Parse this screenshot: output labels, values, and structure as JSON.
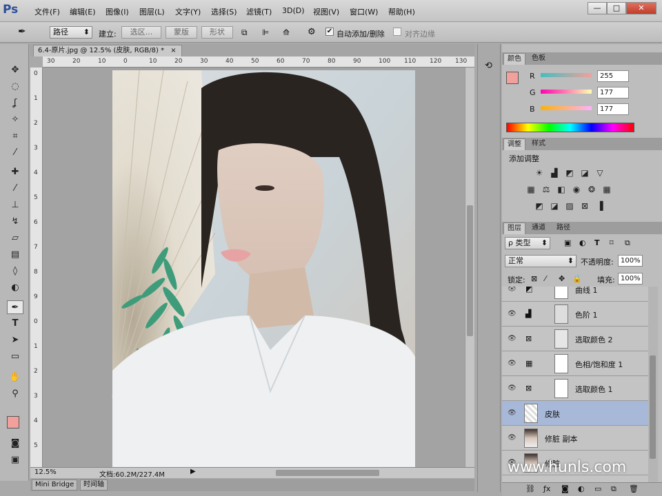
{
  "app": {
    "logo": "Ps"
  },
  "menu": [
    "文件(F)",
    "编辑(E)",
    "图像(I)",
    "图层(L)",
    "文字(Y)",
    "选择(S)",
    "滤镜(T)",
    "3D(D)",
    "视图(V)",
    "窗口(W)",
    "帮助(H)"
  ],
  "window_controls": {
    "minimize": "—",
    "maximize": "□",
    "close": "✕"
  },
  "options": {
    "mode": "路径",
    "make_label": "建立:",
    "selection_btn": "选区...",
    "mask_btn": "蒙版",
    "shape_btn": "形状",
    "auto_add_delete": "自动添加/删除",
    "auto_add_checked": "✔",
    "align_edges": "对齐边缘"
  },
  "document": {
    "tab_title": "6.4-原片.jpg @ 12.5% (皮肤, RGB/8) *",
    "tab_close": "×",
    "zoom": "12.5%",
    "doc_info": "文档:60.2M/227.4M",
    "h_ruler": [
      "30",
      "20",
      "10",
      "0",
      "10",
      "20",
      "30",
      "40",
      "50",
      "60",
      "70",
      "80",
      "90",
      "100",
      "110",
      "120",
      "130"
    ],
    "v_ruler": [
      "0",
      "1",
      "2",
      "3",
      "4",
      "5",
      "6",
      "7",
      "8",
      "9",
      "0",
      "1",
      "2",
      "3",
      "4",
      "5"
    ]
  },
  "bottom_tabs": [
    "Mini Bridge",
    "时间轴"
  ],
  "color_panel": {
    "tabs": [
      "颜色",
      "色板"
    ],
    "foreground": "#f2a09c",
    "r_label": "R",
    "g_label": "G",
    "b_label": "B",
    "r": "255",
    "g": "177",
    "b": "177"
  },
  "adjust_panel": {
    "tabs": [
      "调整",
      "样式"
    ],
    "title": "添加调整"
  },
  "layers_panel": {
    "tabs": [
      "图层",
      "通道",
      "路径"
    ],
    "filter": "ρ 类型",
    "blend_mode": "正常",
    "opacity_label": "不透明度:",
    "opacity": "100%",
    "lock_label": "锁定:",
    "fill_label": "填充:",
    "fill": "100%",
    "layers": [
      {
        "name": "曲线 1"
      },
      {
        "name": "色阶 1"
      },
      {
        "name": "选取颜色 2"
      },
      {
        "name": "色相/饱和度 1"
      },
      {
        "name": "选取颜色 1"
      },
      {
        "name": "皮肤"
      },
      {
        "name": "修脏 副本"
      },
      {
        "name": "修脏"
      }
    ]
  },
  "watermark": "www.hunls.com"
}
